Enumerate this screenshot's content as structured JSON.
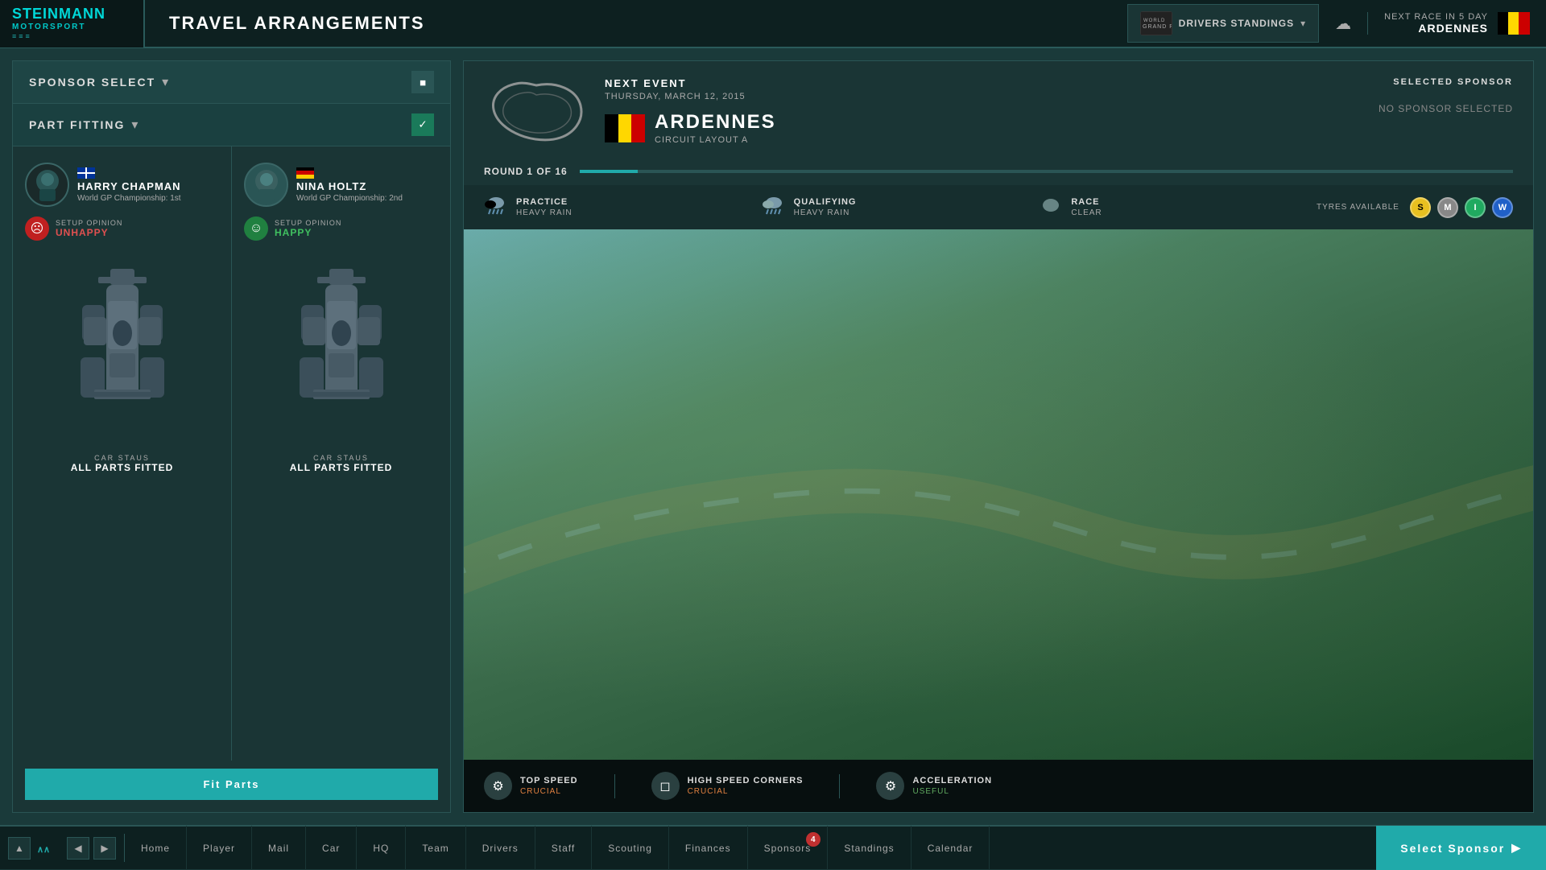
{
  "app": {
    "title": "TRAVEL ARRANGEMENTS",
    "logo_line1": "STEINMANN",
    "logo_line2": "MOTORSPORT"
  },
  "topbar": {
    "standings_label": "DRIVERS\nSTANDINGS",
    "next_race_prefix": "NEXT RACE IN 5 DAY",
    "next_race_name": "ARDENNES"
  },
  "left_panel": {
    "sponsor_select": "SPONSOR SELECT",
    "part_fitting": "PART FITTING",
    "driver1": {
      "name": "HARRY CHAPMAN",
      "championship": "World GP Championship: 1st",
      "setup_label": "SETUP OPINION",
      "setup_status": "UNHAPPY",
      "car_status_label": "CAR STAUS",
      "car_status_value": "ALL PARTS FITTED"
    },
    "driver2": {
      "name": "NINA HOLTZ",
      "championship": "World GP Championship: 2nd",
      "setup_label": "SETUP OPINION",
      "setup_status": "HAPPY",
      "car_status_label": "CAR STAUS",
      "car_status_value": "ALL PARTS FITTED"
    },
    "fit_parts_btn": "Fit Parts"
  },
  "right_panel": {
    "next_event_label": "NEXT EVENT",
    "event_date": "THURSDAY, MARCH 12, 2015",
    "location_name": "ARDENNES",
    "circuit_layout": "CIRCUIT LAYOUT A",
    "selected_sponsor_label": "SELECTED SPONSOR",
    "no_sponsor": "NO SPONSOR SELECTED",
    "round_text": "ROUND 1 OF 16",
    "practice": {
      "label": "PRACTICE",
      "condition": "HEAVY RAIN"
    },
    "qualifying": {
      "label": "QUALIFYING",
      "condition": "HEAVY RAIN"
    },
    "race": {
      "label": "RACE",
      "condition": "CLEAR"
    },
    "tyres_label": "TYRES AVAILABLE",
    "tyres": [
      "S",
      "M",
      "I",
      "W"
    ],
    "attributes": [
      {
        "name": "TOP SPEED",
        "level": "CRUCIAL",
        "icon": "⚙"
      },
      {
        "name": "HIGH SPEED CORNERS",
        "level": "CRUCIAL",
        "icon": "◻"
      },
      {
        "name": "ACCELERATION",
        "level": "USEFUL",
        "icon": "⚙"
      }
    ]
  },
  "bottom_nav": {
    "items": [
      {
        "label": "Home",
        "badge": null
      },
      {
        "label": "Player",
        "badge": null
      },
      {
        "label": "Mail",
        "badge": null
      },
      {
        "label": "Car",
        "badge": null
      },
      {
        "label": "HQ",
        "badge": null
      },
      {
        "label": "Team",
        "badge": null
      },
      {
        "label": "Drivers",
        "badge": null
      },
      {
        "label": "Staff",
        "badge": null
      },
      {
        "label": "Scouting",
        "badge": null
      },
      {
        "label": "Finances",
        "badge": null
      },
      {
        "label": "Sponsors",
        "badge": "4"
      },
      {
        "label": "Standings",
        "badge": null
      },
      {
        "label": "Calendar",
        "badge": null
      }
    ],
    "select_sponsor_btn": "Select Sponsor"
  }
}
